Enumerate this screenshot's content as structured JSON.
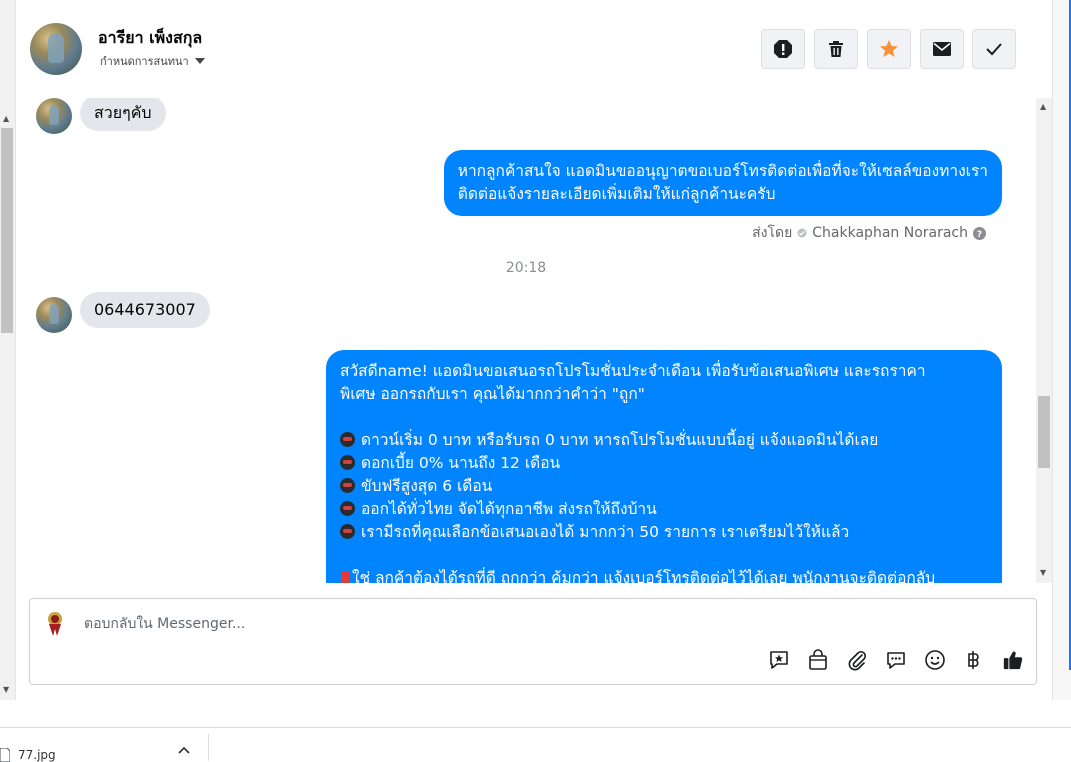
{
  "header": {
    "contact_name": "อารียา เพ็งสกุล",
    "assign_label": "กำหนดการสนทนา",
    "actions": [
      "mark-spam",
      "delete",
      "star",
      "mark-unread",
      "done"
    ]
  },
  "chat": {
    "msg_in_1": "สวยๆคับ",
    "msg_out_1_line1": "หากลูกค้าสนใจ แอดมินขออนุญาตขอเบอร์โทรติดต่อเพื่อที่จะให้เซลล์ของทางเรา",
    "msg_out_1_line2": "ติดต่อแจ้งรายละเอียดเพิ่มเติมให้แก่ลูกค้านะครับ",
    "sent_by_label": "ส่งโดย",
    "sent_by_name": "Chakkaphan Norarach",
    "time_separator": "20:18",
    "msg_in_2": "0644673007",
    "msg_out_2": {
      "line1": "สวัสดีname! แอดมินขอเสนอรถโปรโมชั่นประจำเดือน เพื่อรับข้อเสนอพิเศษ และรถราคา",
      "line2": "พิเศษ ออกรถกับเรา คุณได้มากกว่าคำว่า \"ถูก\"",
      "bullets": [
        "ดาวน์เริ่ม 0 บาท หรือรับรถ 0 บาท หารถโปรโมชั่นแบบนี้อยู่ แจ้งแอดมินได้เลย",
        "ดอกเบี้ย 0% นานถึง 12 เดือน",
        "ขับฟรีสูงสุด 6 เดือน",
        "ออกได้ทั่วไทย จัดได้ทุกอาชีพ ส่งรถให้ถึงบ้าน",
        "เรามีรถที่คุณเลือกข้อเสนอเองได้ มากกว่า 50 รายการ เราเตรียมไว้ให้แล้ว"
      ],
      "cut_line": "ใช่ ลูกค้าต้องได้รถที่ดี ถูกกว่า คุ้มกว่า แจ้งเบอร์โทรติดต่อไว้ได้เลย พนักงานจะติดต่อกลับ"
    }
  },
  "composer": {
    "placeholder": "ตอบกลับใน Messenger...",
    "tools": [
      "saved-reply",
      "shop",
      "attach",
      "quick-reply",
      "emoji",
      "baht",
      "like"
    ]
  },
  "download_bar": {
    "filename": "77.jpg"
  },
  "colors": {
    "accent": "#0084ff",
    "star": "#f7923a",
    "bubble_in": "#e4e6eb"
  }
}
